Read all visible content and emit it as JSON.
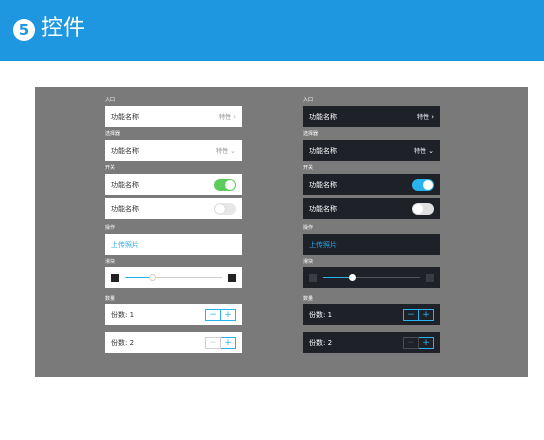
{
  "header": {
    "step_number": "5",
    "title": "控件"
  },
  "sections": {
    "entry": "入口",
    "selector": "选择器",
    "switch": "开关",
    "action": "操作",
    "slider": "滑块",
    "quantity": "数量"
  },
  "rows": {
    "feature_name": "功能名称",
    "feature_value": "特性",
    "upload_photo": "上传照片",
    "copies_1": "份数: 1",
    "copies_2": "份数: 2"
  },
  "icons": {
    "chevron_right": "›",
    "chevron_down": "⌄",
    "minus": "−",
    "plus": "+"
  },
  "controls": {
    "switch_1_on": true,
    "switch_2_on": false,
    "light_slider_level": 0.28,
    "dark_slider_level": 0.3
  },
  "colors": {
    "header_blue": "#1f97e0",
    "canvas_gray": "#7a7a7a",
    "dark_row": "#1f2129",
    "accent_blue": "#29b3ee",
    "toggle_green": "#5ccc5c"
  }
}
